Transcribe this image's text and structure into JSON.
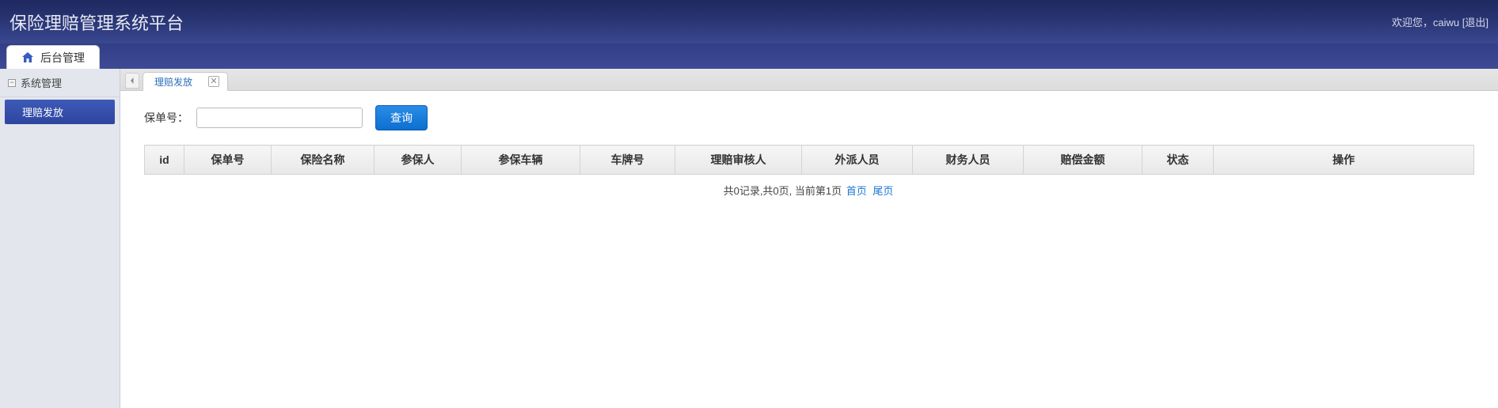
{
  "header": {
    "title": "保险理赔管理系统平台",
    "welcome_prefix": "欢迎您，",
    "username": "caiwu",
    "logout": "[退出]"
  },
  "main_tab": {
    "label": "后台管理"
  },
  "sidebar": {
    "group_label": "系统管理",
    "items": [
      {
        "label": "理赔发放"
      }
    ]
  },
  "content_tab": {
    "label": "理赔发放"
  },
  "search": {
    "label": "保单号：",
    "value": "",
    "button": "查询"
  },
  "table": {
    "columns": [
      "id",
      "保单号",
      "保险名称",
      "参保人",
      "参保车辆",
      "车牌号",
      "理赔审核人",
      "外派人员",
      "财务人员",
      "赔偿金额",
      "状态",
      "操作"
    ],
    "rows": []
  },
  "pagination": {
    "summary": "共0记录,共0页, 当前第1页 ",
    "first": "首页",
    "last": "尾页"
  }
}
